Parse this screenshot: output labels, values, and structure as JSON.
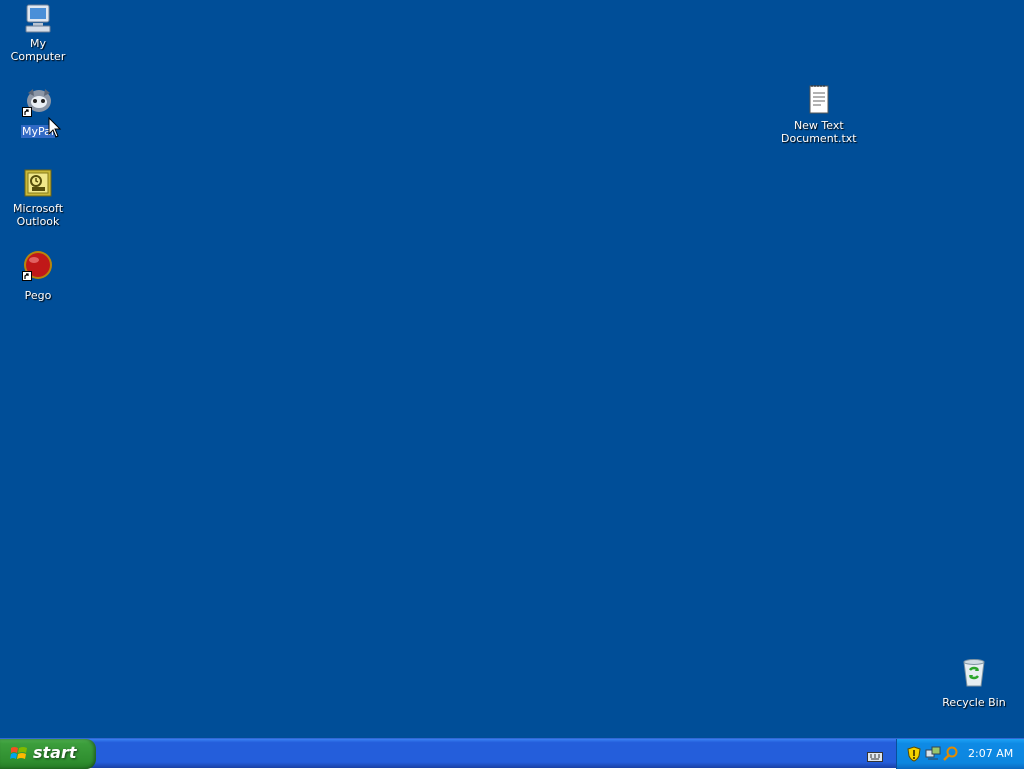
{
  "desktop": {
    "background_color": "#004e98",
    "icons": [
      {
        "label": "My Computer",
        "icon": "computer-icon"
      },
      {
        "label": "MyPal",
        "icon": "mypal-browser-icon",
        "shortcut": true,
        "selected": true
      },
      {
        "label": "Microsoft\nOutlook",
        "icon": "outlook-icon"
      },
      {
        "label": "Pego",
        "icon": "pego-icon",
        "shortcut": true
      },
      {
        "label": "New Text\nDocument.txt",
        "icon": "text-document-icon"
      },
      {
        "label": "Recycle Bin",
        "icon": "recycle-bin-icon"
      }
    ]
  },
  "taskbar": {
    "start_label": "start",
    "tray": {
      "clock": "2:07 AM",
      "icons": [
        "security-shield-icon",
        "network-icon",
        "search-icon"
      ]
    },
    "language_bar_icon": "keyboard-icon"
  }
}
